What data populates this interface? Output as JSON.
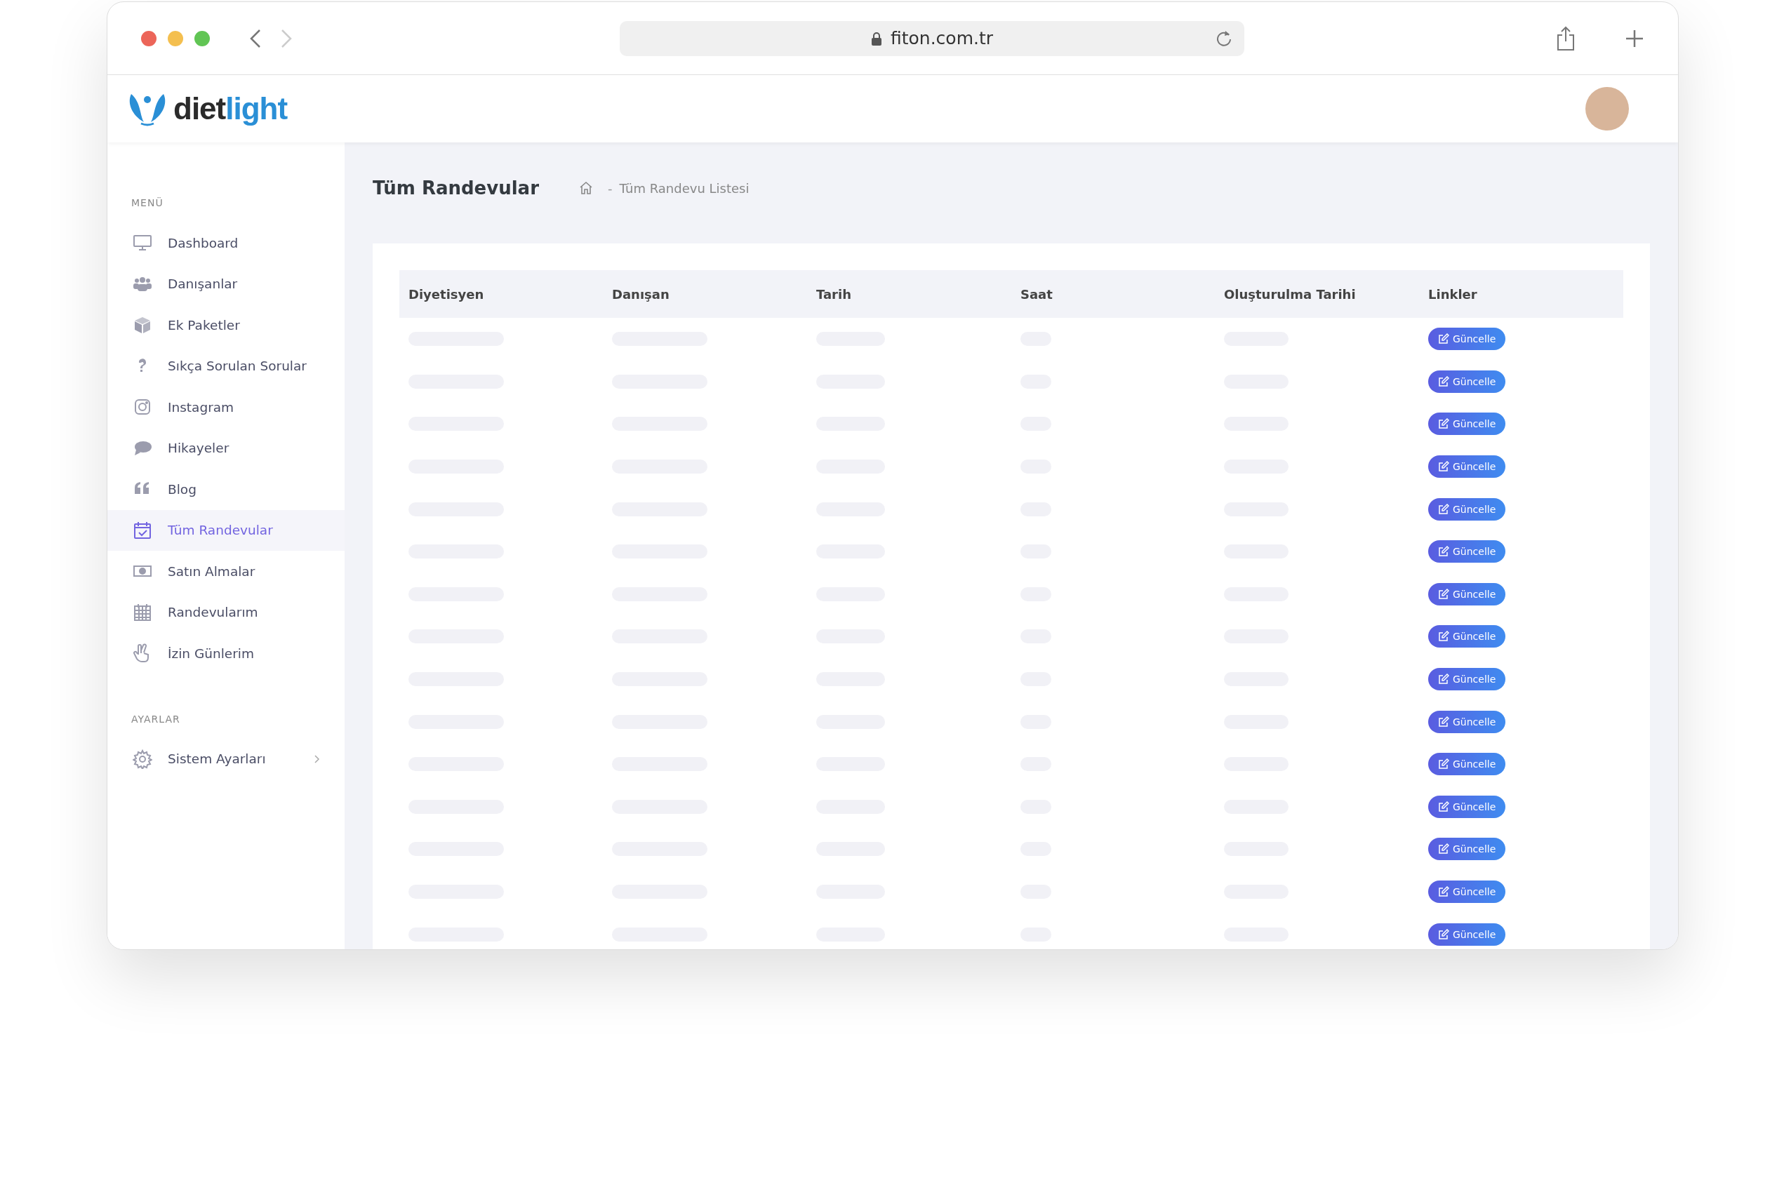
{
  "browser": {
    "url": "fiton.com.tr"
  },
  "header": {
    "logo_dark": "diet",
    "logo_light": "light"
  },
  "sidebar": {
    "sections": [
      {
        "title": "MENÜ",
        "items": [
          {
            "label": "Dashboard",
            "kind": "monitor",
            "selected": false
          },
          {
            "label": "Danışanlar",
            "kind": "users",
            "selected": false
          },
          {
            "label": "Ek Paketler",
            "kind": "box",
            "selected": false
          },
          {
            "label": "Sıkça Sorulan Sorular",
            "kind": "question",
            "selected": false
          },
          {
            "label": "Instagram",
            "kind": "instagram",
            "selected": false
          },
          {
            "label": "Hikayeler",
            "kind": "chat",
            "selected": false
          },
          {
            "label": "Blog",
            "kind": "quote",
            "selected": false
          },
          {
            "label": "Tüm Randevular",
            "kind": "calendar",
            "selected": true
          },
          {
            "label": "Satın Almalar",
            "kind": "money",
            "selected": false
          },
          {
            "label": "Randevularım",
            "kind": "schedule",
            "selected": false
          },
          {
            "label": "İzin Günlerim",
            "kind": "hand",
            "selected": false
          }
        ]
      },
      {
        "title": "AYARLAR",
        "items": [
          {
            "label": "Sistem Ayarları",
            "kind": "gear",
            "selected": false,
            "submenu": true
          }
        ]
      }
    ]
  },
  "page": {
    "title": "Tüm Randevular",
    "separator": "-",
    "breadcrumb": "Tüm Randevu Listesi"
  },
  "table": {
    "columns": [
      "Diyetisyen",
      "Danışan",
      "Tarih",
      "Saat",
      "Oluşturulma Tarihi",
      "Linkler"
    ],
    "rows": [
      {
        "button": "Güncelle"
      },
      {
        "button": "Güncelle"
      },
      {
        "button": "Güncelle"
      },
      {
        "button": "Güncelle"
      },
      {
        "button": "Güncelle"
      },
      {
        "button": "Güncelle"
      },
      {
        "button": "Güncelle"
      },
      {
        "button": "Güncelle"
      },
      {
        "button": "Güncelle"
      },
      {
        "button": "Güncelle"
      },
      {
        "button": "Güncelle"
      },
      {
        "button": "Güncelle"
      },
      {
        "button": "Güncelle"
      },
      {
        "button": "Güncelle"
      },
      {
        "button": "Güncelle"
      }
    ]
  }
}
